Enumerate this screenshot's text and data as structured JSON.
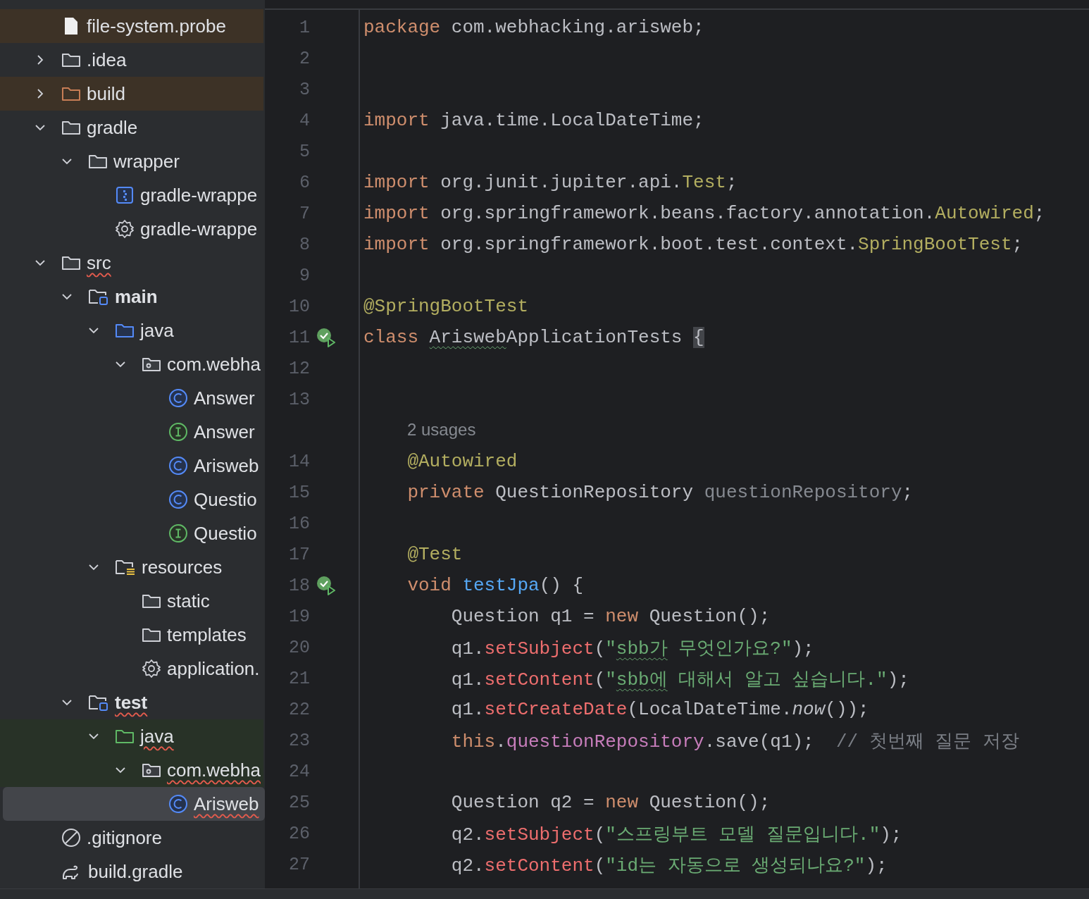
{
  "project_tree": [
    {
      "label": "file-system.probe",
      "kind": "file",
      "color": "#3d3226",
      "selected": false,
      "error": false
    },
    {
      "label": ".idea",
      "kind": "folder",
      "expanded": false,
      "selected": false,
      "error": false
    },
    {
      "label": "build",
      "kind": "excluded-folder",
      "expanded": false,
      "color": "#3d3226",
      "selected": false,
      "error": false
    },
    {
      "label": "gradle",
      "kind": "folder",
      "expanded": true,
      "selected": false,
      "error": false,
      "children": [
        {
          "label": "wrapper",
          "kind": "folder",
          "expanded": true,
          "selected": false,
          "error": false,
          "children": [
            {
              "label": "gradle-wrappe",
              "kind": "archive",
              "selected": false,
              "error": false
            },
            {
              "label": "gradle-wrappe",
              "kind": "gear",
              "selected": false,
              "error": false
            }
          ]
        }
      ]
    },
    {
      "label": "src",
      "kind": "folder",
      "expanded": true,
      "selected": false,
      "error": true,
      "children": [
        {
          "label": "main",
          "kind": "module",
          "bold": true,
          "expanded": true,
          "selected": false,
          "error": false,
          "children": [
            {
              "label": "java",
              "kind": "source-folder",
              "expanded": true,
              "selected": false,
              "error": false,
              "children": [
                {
                  "label": "com.webha",
                  "kind": "package",
                  "expanded": true,
                  "selected": false,
                  "error": false,
                  "children": [
                    {
                      "label": "Answer",
                      "kind": "class",
                      "selected": false,
                      "error": false
                    },
                    {
                      "label": "Answer",
                      "kind": "interface",
                      "selected": false,
                      "error": false
                    },
                    {
                      "label": "Arisweb",
                      "kind": "class",
                      "selected": false,
                      "error": false
                    },
                    {
                      "label": "Questio",
                      "kind": "class",
                      "selected": false,
                      "error": false
                    },
                    {
                      "label": "Questio",
                      "kind": "interface",
                      "selected": false,
                      "error": false
                    }
                  ]
                }
              ]
            },
            {
              "label": "resources",
              "kind": "resources",
              "expanded": true,
              "selected": false,
              "error": false,
              "children": [
                {
                  "label": "static",
                  "kind": "folder",
                  "selected": false,
                  "error": false
                },
                {
                  "label": "templates",
                  "kind": "folder",
                  "selected": false,
                  "error": false
                },
                {
                  "label": "application.",
                  "kind": "gear",
                  "selected": false,
                  "error": false
                }
              ]
            }
          ]
        },
        {
          "label": "test",
          "kind": "module",
          "bold": true,
          "expanded": true,
          "selected": false,
          "error": true,
          "children": [
            {
              "label": "java",
              "kind": "test-folder",
              "expanded": true,
              "color": "#283227",
              "selected": false,
              "error": true,
              "children": [
                {
                  "label": "com.webha",
                  "kind": "package",
                  "expanded": true,
                  "color": "#283227",
                  "selected": false,
                  "error": true,
                  "children": [
                    {
                      "label": "Arisweb",
                      "kind": "class",
                      "selected": true,
                      "error": true
                    }
                  ]
                }
              ]
            }
          ]
        }
      ]
    },
    {
      "label": ".gitignore",
      "kind": "ignore",
      "selected": false,
      "error": false
    },
    {
      "label": "build.gradle",
      "kind": "gradle",
      "selected": false,
      "error": false
    }
  ],
  "editor_lines": [
    {
      "number": "1",
      "tokens": [
        {
          "kind": "keyword",
          "text": "package"
        },
        {
          "kind": "plain",
          "text": " com.webhacking.arisweb;"
        }
      ]
    },
    {
      "number": "2"
    },
    {
      "number": "3"
    },
    {
      "number": "4",
      "tokens": [
        {
          "kind": "keyword",
          "text": "import"
        },
        {
          "kind": "plain",
          "text": " java.time.LocalDateTime;"
        }
      ]
    },
    {
      "number": "5"
    },
    {
      "number": "6",
      "tokens": [
        {
          "kind": "keyword",
          "text": "import"
        },
        {
          "kind": "plain",
          "text": " org.junit.jupiter.api."
        },
        {
          "kind": "annotation",
          "text": "Test"
        },
        {
          "kind": "plain",
          "text": ";"
        }
      ]
    },
    {
      "number": "7",
      "tokens": [
        {
          "kind": "keyword",
          "text": "import"
        },
        {
          "kind": "plain",
          "text": " org.springframework.beans.factory.annotation."
        },
        {
          "kind": "annotation",
          "text": "Autowired"
        },
        {
          "kind": "plain",
          "text": ";"
        }
      ]
    },
    {
      "number": "8",
      "tokens": [
        {
          "kind": "keyword",
          "text": "import"
        },
        {
          "kind": "plain",
          "text": " org.springframework.boot.test.context."
        },
        {
          "kind": "annotation",
          "text": "SpringBootTest"
        },
        {
          "kind": "plain",
          "text": ";"
        }
      ]
    },
    {
      "number": "9"
    },
    {
      "number": "10",
      "tokens": [
        {
          "kind": "annotation",
          "text": "@SpringBootTest"
        }
      ]
    },
    {
      "number": "11",
      "run_marker": true,
      "tokens": [
        {
          "kind": "keyword",
          "text": "class "
        },
        {
          "kind": "plain",
          "text": "Arisweb",
          "squiggle": true
        },
        {
          "kind": "plain",
          "text": "ApplicationTests "
        },
        {
          "kind": "brace",
          "text": "{"
        }
      ]
    },
    {
      "number": "12"
    },
    {
      "number": "13"
    },
    {
      "kind": "inlay",
      "text": "2 usages"
    },
    {
      "number": "14",
      "tokens": [
        {
          "kind": "annotation",
          "text": "    @Autowired"
        }
      ]
    },
    {
      "number": "15",
      "tokens": [
        {
          "kind": "keyword",
          "text": "    private"
        },
        {
          "kind": "plain",
          "text": " QuestionRepository "
        },
        {
          "kind": "unused",
          "text": "questionRepository"
        },
        {
          "kind": "plain",
          "text": ";"
        }
      ]
    },
    {
      "number": "16"
    },
    {
      "number": "17",
      "tokens": [
        {
          "kind": "annotation",
          "text": "    @Test"
        }
      ]
    },
    {
      "number": "18",
      "run_marker": true,
      "tokens": [
        {
          "kind": "keyword",
          "text": "    void "
        },
        {
          "kind": "declaration",
          "text": "testJpa"
        },
        {
          "kind": "plain",
          "text": "() {"
        }
      ]
    },
    {
      "number": "19",
      "tokens": [
        {
          "kind": "plain",
          "text": "        Question q1 = "
        },
        {
          "kind": "keyword",
          "text": "new"
        },
        {
          "kind": "plain",
          "text": " Question();"
        }
      ]
    },
    {
      "number": "20",
      "tokens": [
        {
          "kind": "plain",
          "text": "        q1."
        },
        {
          "kind": "method",
          "text": "setSubject"
        },
        {
          "kind": "plain",
          "text": "("
        },
        {
          "kind": "string",
          "text": "\""
        },
        {
          "kind": "string",
          "text": "sbb가",
          "squiggle": true
        },
        {
          "kind": "string",
          "text": " 무엇인가요?\""
        },
        {
          "kind": "plain",
          "text": ");"
        }
      ]
    },
    {
      "number": "21",
      "tokens": [
        {
          "kind": "plain",
          "text": "        q1."
        },
        {
          "kind": "method",
          "text": "setContent"
        },
        {
          "kind": "plain",
          "text": "("
        },
        {
          "kind": "string",
          "text": "\""
        },
        {
          "kind": "string",
          "text": "sbb에",
          "squiggle": true
        },
        {
          "kind": "string",
          "text": " 대해서 알고 싶습니다.\""
        },
        {
          "kind": "plain",
          "text": ");"
        }
      ]
    },
    {
      "number": "22",
      "tokens": [
        {
          "kind": "plain",
          "text": "        q1."
        },
        {
          "kind": "method",
          "text": "setCreateDate"
        },
        {
          "kind": "plain",
          "text": "(LocalDateTime."
        },
        {
          "kind": "static-call",
          "text": "now"
        },
        {
          "kind": "plain",
          "text": "());"
        }
      ]
    },
    {
      "number": "23",
      "tokens": [
        {
          "kind": "keyword",
          "text": "        this"
        },
        {
          "kind": "plain",
          "text": "."
        },
        {
          "kind": "field",
          "text": "questionRepository"
        },
        {
          "kind": "plain",
          "text": ".save(q1);  "
        },
        {
          "kind": "comment",
          "text": "// 첫번째 질문 저장"
        }
      ]
    },
    {
      "number": "24"
    },
    {
      "number": "25",
      "tokens": [
        {
          "kind": "plain",
          "text": "        Question q2 = "
        },
        {
          "kind": "keyword",
          "text": "new"
        },
        {
          "kind": "plain",
          "text": " Question();"
        }
      ]
    },
    {
      "number": "26",
      "tokens": [
        {
          "kind": "plain",
          "text": "        q2."
        },
        {
          "kind": "method",
          "text": "setSubject"
        },
        {
          "kind": "plain",
          "text": "("
        },
        {
          "kind": "string",
          "text": "\"스프링부트 모델 질문입니다.\""
        },
        {
          "kind": "plain",
          "text": ");"
        }
      ]
    },
    {
      "number": "27",
      "tokens": [
        {
          "kind": "plain",
          "text": "        q2."
        },
        {
          "kind": "method",
          "text": "setContent"
        },
        {
          "kind": "plain",
          "text": "("
        },
        {
          "kind": "string",
          "text": "\"id는 자동으로 생성되나요?\""
        },
        {
          "kind": "plain",
          "text": ");"
        }
      ]
    }
  ]
}
